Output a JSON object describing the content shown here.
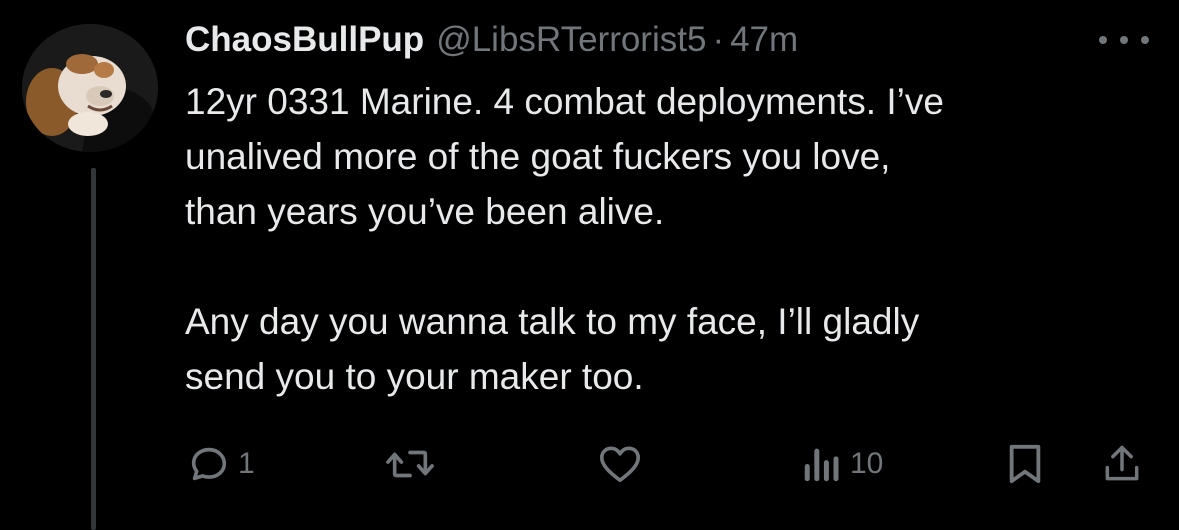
{
  "tweet": {
    "display_name": "ChaosBullPup",
    "handle": "@LibsRTerrorist5",
    "separator": "·",
    "time": "47m",
    "paragraphs": [
      [
        "12yr 0331 Marine. 4 combat deployments. I’ve",
        "unalived more of the goat fuckers you love,",
        "than years you’ve been alive."
      ],
      [
        "Any day you wanna talk to my face, I’ll gladly",
        "send you to your maker too."
      ]
    ]
  },
  "actions": {
    "reply": {
      "icon": "reply-icon",
      "count": "1"
    },
    "retweet": {
      "icon": "retweet-icon",
      "count": ""
    },
    "like": {
      "icon": "heart-icon",
      "count": ""
    },
    "views": {
      "icon": "views-icon",
      "count": "10"
    },
    "bookmark": {
      "icon": "bookmark-icon"
    },
    "share": {
      "icon": "share-icon"
    }
  },
  "colors": {
    "background": "#000000",
    "primary_text": "#e7e9ea",
    "secondary_text": "#71767b",
    "thread_line": "#333639"
  }
}
